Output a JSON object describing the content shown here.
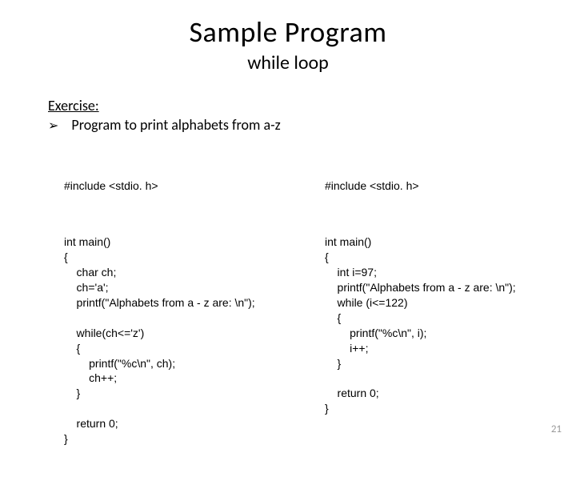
{
  "title": "Sample Program",
  "subtitle": "while loop",
  "exercise_label": "Exercise:",
  "bullet_glyph": "➢",
  "bullet_text": "Program to print alphabets from a-z",
  "code_left": {
    "include": "#include <stdio. h>",
    "body": "int main()\n{\n    char ch;\n    ch='a';\n    printf(\"Alphabets from a - z are: \\n\");\n\n    while(ch<='z')\n    {\n        printf(\"%c\\n\", ch);\n        ch++;\n    }\n\n    return 0;\n}"
  },
  "code_right": {
    "include": "#include <stdio. h>",
    "body": "int main()\n{\n    int i=97;\n    printf(\"Alphabets from a - z are: \\n\");\n    while (i<=122)\n    {\n        printf(\"%c\\n\", i);\n        i++;\n    }\n\n    return 0;\n}"
  },
  "page_number": "21"
}
